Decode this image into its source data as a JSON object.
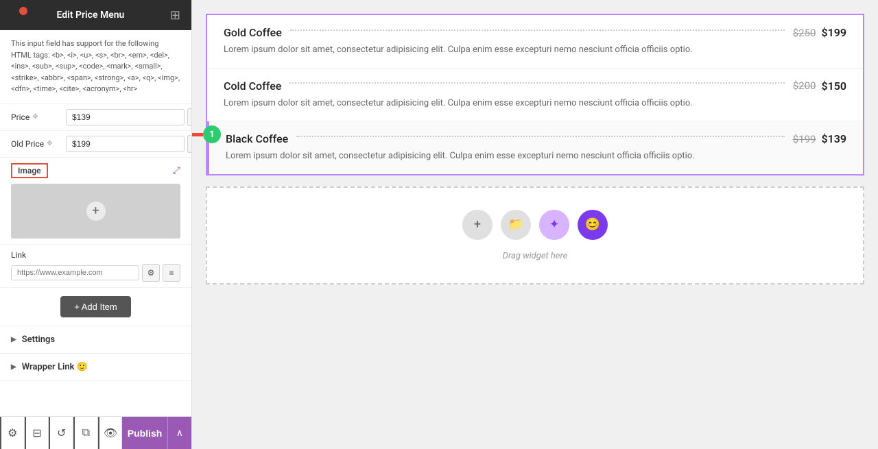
{
  "header": {
    "title": "Edit Price Menu",
    "grid_icon": "⊞"
  },
  "html_info": "This input field has support for the following HTML tags: <b>, <i>, <u>, <s>, <br>, <em>, <del>, <ins>, <sub>, <sup>, <code>, <mark>, <small>, <strike>, <abbr>, <span>, <strong>, <a>, <q>, <img>, <dfn>, <time>, <cite>, <acronym>, <hr>",
  "fields": {
    "price_label": "Price",
    "price_value": "$139",
    "old_price_label": "Old Price",
    "old_price_value": "$199"
  },
  "image": {
    "label": "Image"
  },
  "link": {
    "label": "Link",
    "placeholder": "https://www.example.com"
  },
  "add_item_btn": "+ Add Item",
  "settings": {
    "label": "Settings"
  },
  "wrapper_link": {
    "label": "Wrapper Link"
  },
  "footer": {
    "publish_label": "Publish"
  },
  "menu_items": [
    {
      "name": "Gold Coffee",
      "old_price": "$250",
      "new_price": "$199",
      "description": "Lorem ipsum dolor sit amet, consectetur adipisicing elit. Culpa enim esse excepturi nemo nesciunt officia officiis optio."
    },
    {
      "name": "Cold Coffee",
      "old_price": "$200",
      "new_price": "$150",
      "description": "Lorem ipsum dolor sit amet, consectetur adipisicing elit. Culpa enim esse excepturi nemo nesciunt officia officiis optio."
    },
    {
      "name": "Black Coffee",
      "old_price": "$199",
      "new_price": "$139",
      "description": "Lorem ipsum dolor sit amet, consectetur adipisicing elit. Culpa enim esse excepturi nemo nesciunt officia officiis optio."
    }
  ],
  "drop_zone": {
    "text": "Drag widget here",
    "icons": [
      "+",
      "📁",
      "✦",
      "😊"
    ]
  }
}
